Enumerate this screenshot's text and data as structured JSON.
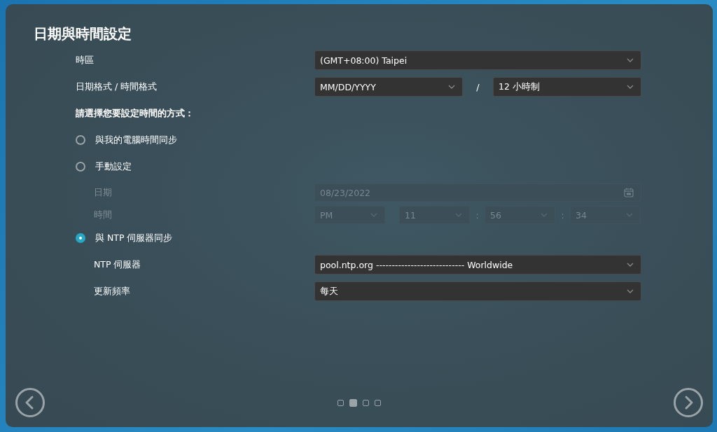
{
  "title": "日期與時間設定",
  "timezone": {
    "label": "時區",
    "value": "(GMT+08:00) Taipei"
  },
  "format": {
    "label": "日期格式 / 時間格式",
    "date_value": "MM/DD/YYYY",
    "separator": "/",
    "time_value": "12 小時制"
  },
  "prompt": "請選擇您要設定時間的方式：",
  "methods": [
    {
      "label": "與我的電腦時間同步",
      "selected": false
    },
    {
      "label": "手動設定",
      "selected": false
    }
  ],
  "manual": {
    "disabled": true,
    "date_label": "日期",
    "date_value": "08/23/2022",
    "time_label": "時間",
    "time_fields": [
      "PM",
      "11",
      "56",
      "34"
    ],
    "time_separators": [
      ":",
      ":"
    ]
  },
  "ntp_method": {
    "label": "與 NTP 伺服器同步",
    "selected": true
  },
  "ntp": {
    "server_label": "NTP 伺服器",
    "server_value": "pool.ntp.org ---------------------------- Worldwide",
    "frequency_label": "更新頻率",
    "frequency_value": "每天"
  },
  "pager": [
    {
      "selected": false
    },
    {
      "selected": true
    },
    {
      "selected": false
    },
    {
      "selected": false
    }
  ]
}
